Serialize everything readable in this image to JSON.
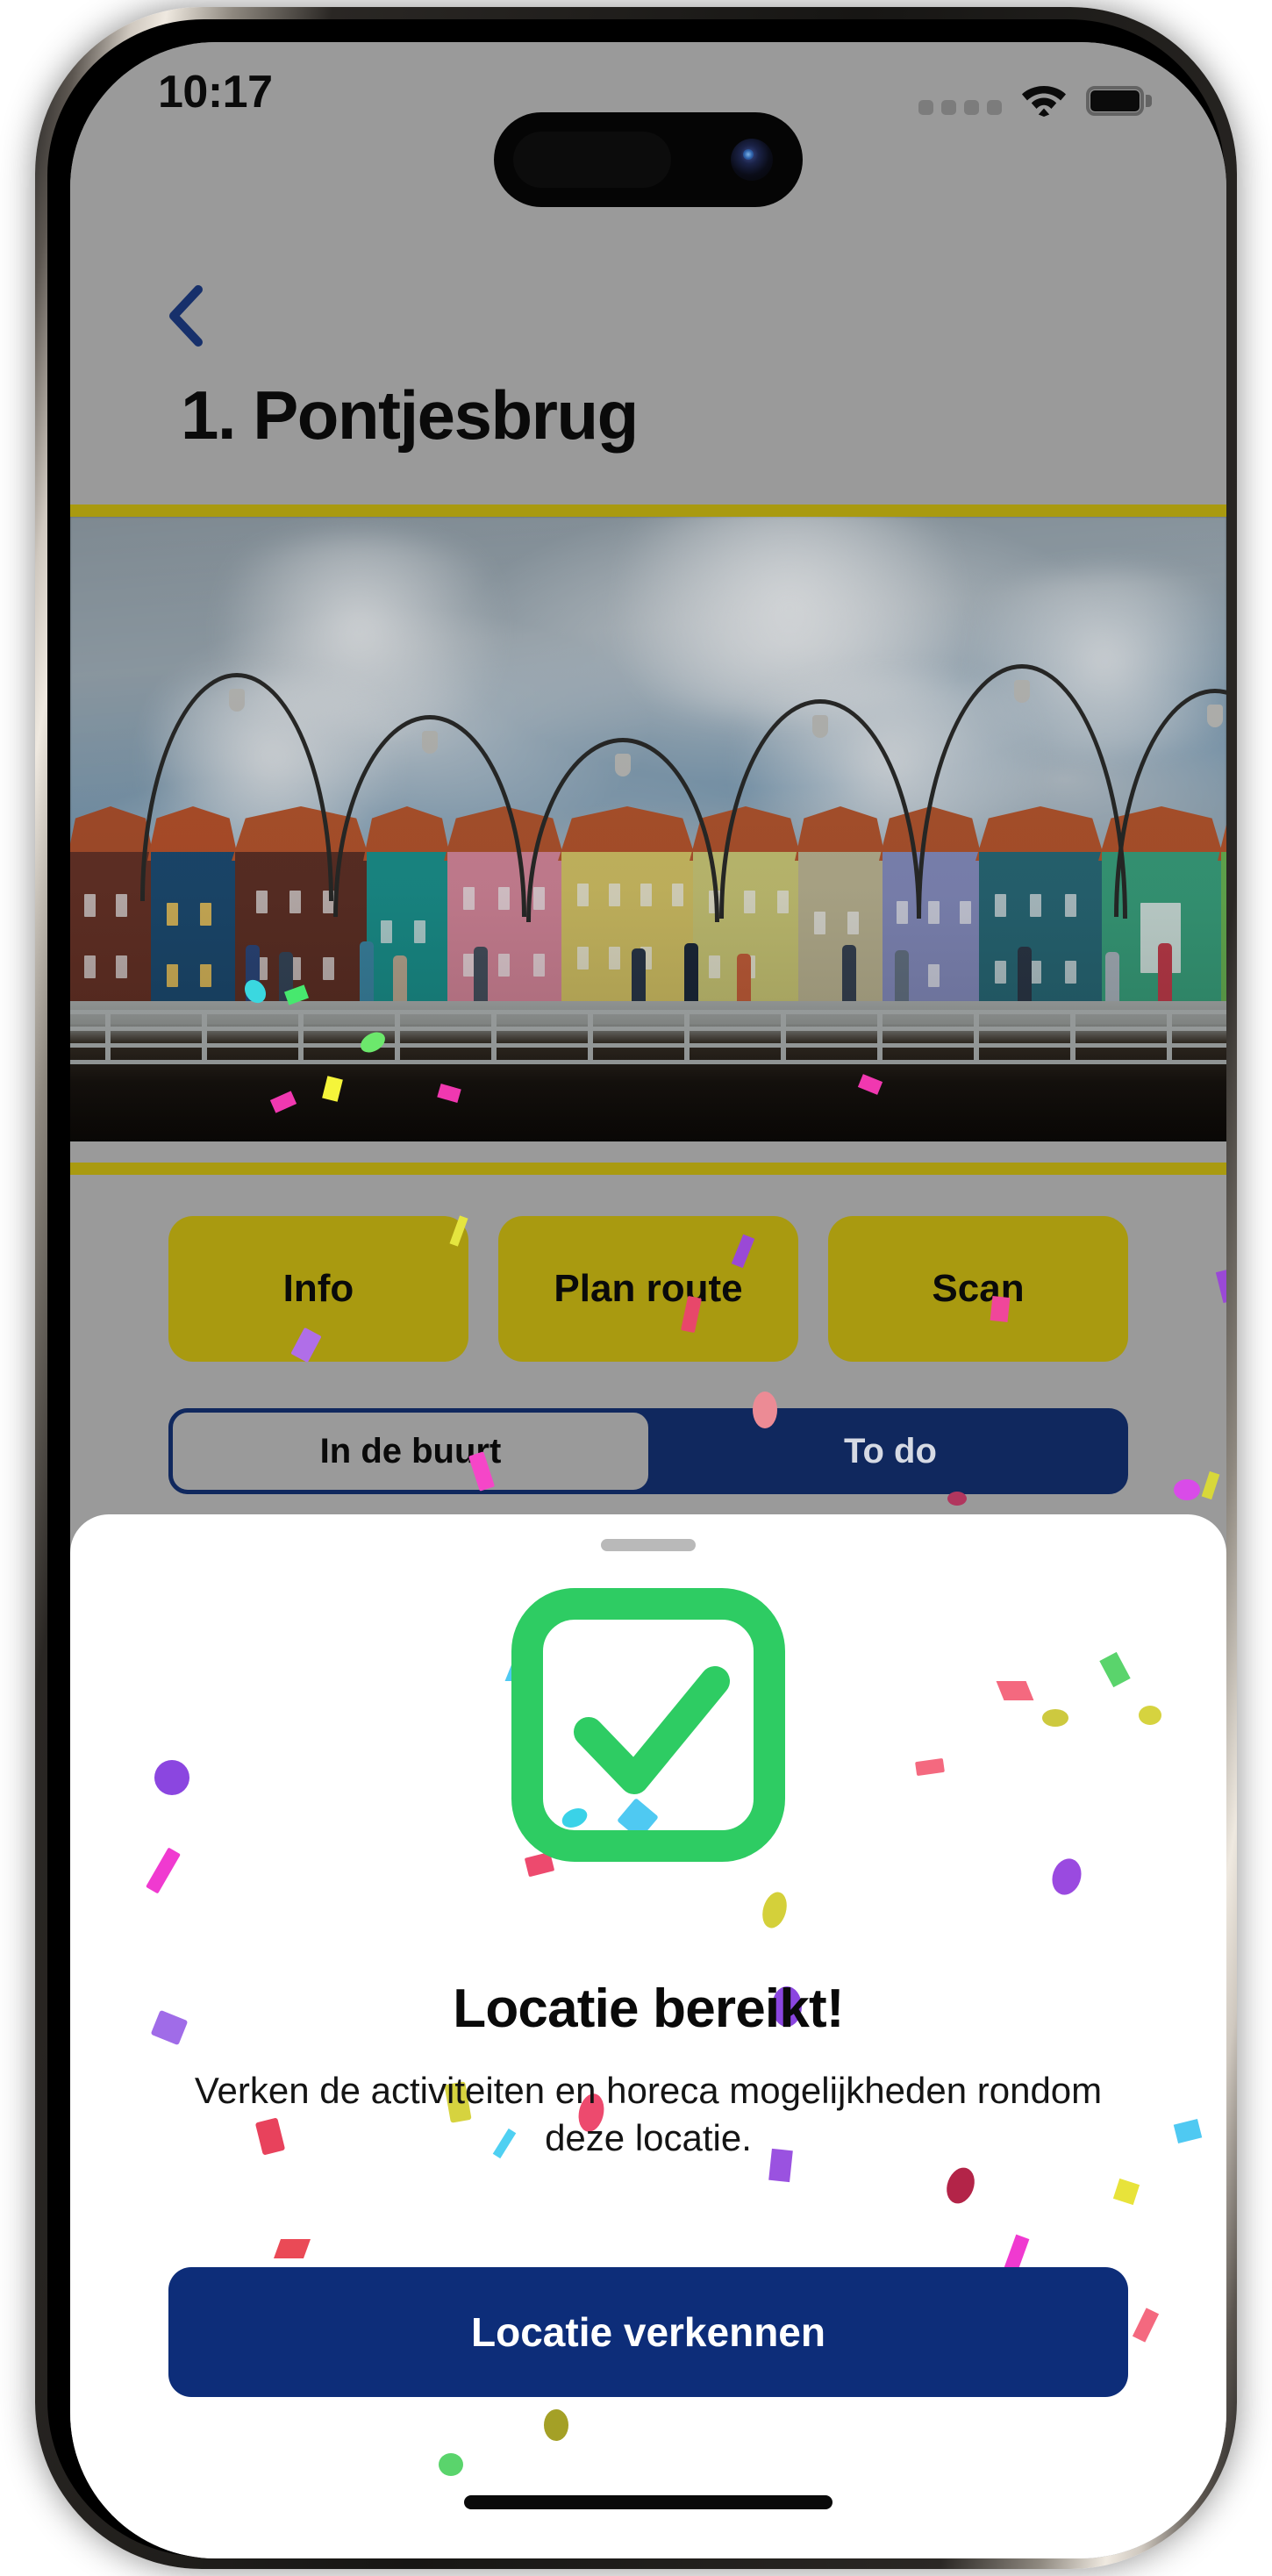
{
  "status_bar": {
    "time": "10:17",
    "cellular_icon": "cellular-dots-icon",
    "wifi_icon": "wifi-icon",
    "battery_icon": "battery-full-icon"
  },
  "nav": {
    "back_icon": "chevron-left-icon"
  },
  "header": {
    "title": "1. Pontjesbrug"
  },
  "hero": {
    "image_alt": "Pontjesbrug Willemstad Curacao floating bridge with colorful waterfront houses",
    "divider_color": "#a99a10"
  },
  "actions": {
    "buttons": [
      {
        "label": "Info",
        "name": "info-button"
      },
      {
        "label": "Plan route",
        "name": "plan-route-button"
      },
      {
        "label": "Scan",
        "name": "scan-button"
      }
    ]
  },
  "segmented": {
    "selected_index": 0,
    "options": [
      {
        "label": "In de buurt"
      },
      {
        "label": "To do"
      }
    ]
  },
  "sheet": {
    "grabber": "sheet-grabber",
    "success_icon": "checkmark-square-icon",
    "heading": "Locatie bereikt!",
    "subtitle": "Verken de activiteiten en horeca mogelijkheden rondom deze locatie.",
    "cta_label": "Locatie verkennen"
  },
  "colors": {
    "gold": "#a99a10",
    "navy": "#10285e",
    "cta_navy": "#0d2d79",
    "success_green": "#2ecc63",
    "screen_bg": "#9a9a9a",
    "sheet_bg": "#ffffff"
  }
}
